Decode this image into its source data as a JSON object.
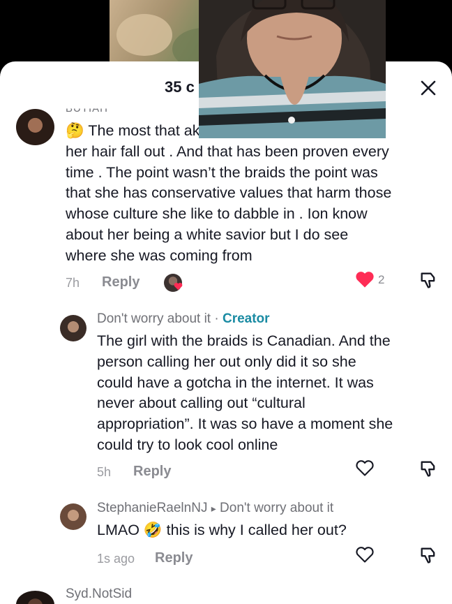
{
  "sheet": {
    "title": "35 c",
    "close_icon": "close-icon"
  },
  "comments": [
    {
      "user": "BUTIAH",
      "text_lines": [
        "🤔 The most that                               ake",
        "her hair fall out . And that has been proven every",
        "time . The point wasn’t the braids the point was",
        "that she has conservative values that harm those",
        "whose culture she like to dabble in . Ion know",
        "about her being a white savior but I do see",
        "where she was coming from"
      ],
      "time": "7h",
      "reply_label": "Reply",
      "likes": "2",
      "liked": true
    },
    {
      "user": "Don't worry about it",
      "separator": " · ",
      "badge": "Creator",
      "text_lines": [
        "The girl with the braids is Canadian. And the",
        "person calling her out only did it so she",
        "could have a gotcha in the internet. It was",
        "never about calling out “cultural",
        "appropriation”. It was so have a moment she",
        "could try to look cool online"
      ],
      "time": "5h",
      "reply_label": "Reply"
    },
    {
      "user": "StephanieRaelnNJ",
      "reply_arrow": "▸",
      "reply_to": "Don't worry about it",
      "text": "LMAO 🤣 this is why I called her out?",
      "time": "1s ago",
      "reply_label": "Reply"
    },
    {
      "user": "Syd.NotSid"
    }
  ],
  "colors": {
    "like_red": "#fe2c55",
    "creator_teal": "#1a8ba3",
    "muted_text": "#8a8b91"
  }
}
